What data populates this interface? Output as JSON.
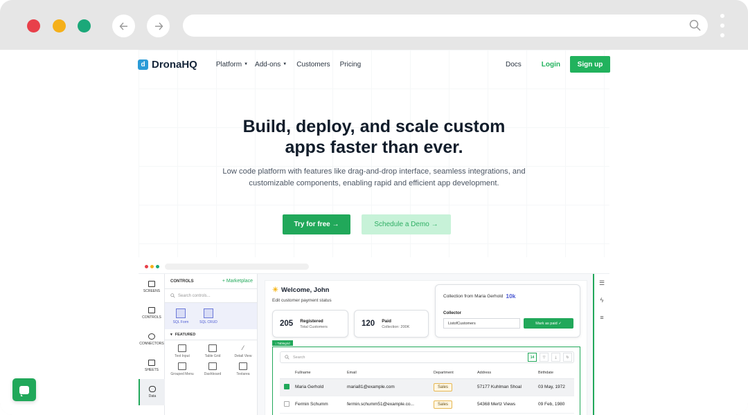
{
  "browser": {
    "traffic_lights": [
      "#e8404a",
      "#f5b01a",
      "#1ba879"
    ],
    "back_icon": "arrow-left-icon",
    "forward_icon": "arrow-right-icon",
    "url": "",
    "search_icon": "search-icon",
    "menu_icon": "kebab-menu-icon"
  },
  "header": {
    "logo_text": "DronaHQ",
    "nav": [
      {
        "label": "Platform",
        "dropdown": true
      },
      {
        "label": "Add-ons",
        "dropdown": true
      },
      {
        "label": "Customers",
        "dropdown": false
      },
      {
        "label": "Pricing",
        "dropdown": false
      }
    ],
    "docs": "Docs",
    "login": "Login",
    "signup": "Sign up"
  },
  "hero": {
    "title_line1": "Build, deploy, and scale custom",
    "title_line2": "apps faster than ever.",
    "subtitle": "Low code platform with features like drag-and-drop interface, seamless integrations, and customizable components, enabling rapid and efficient app development.",
    "cta_primary": "Try for free →",
    "cta_secondary": "Schedule a Demo →"
  },
  "app_preview": {
    "left_nav": [
      {
        "label": "SCREENS",
        "icon": "screens-icon"
      },
      {
        "label": "CONTROLS",
        "icon": "controls-icon"
      },
      {
        "label": "CONNECTORS",
        "icon": "connectors-icon"
      },
      {
        "label": "SHEETS",
        "icon": "sheets-icon"
      },
      {
        "label": "Data",
        "icon": "database-icon"
      }
    ],
    "controls": {
      "heading": "CONTROLS",
      "marketplace": "+ Marketplace",
      "search_placeholder": "Search controls...",
      "sql": [
        "SQL Form",
        "SQL CRUD"
      ],
      "featured": "FEATURED",
      "components": [
        "Text Input",
        "Table Grid",
        "Detail View",
        "Grouped Menu",
        "Dashboard",
        "Textarea"
      ]
    },
    "welcome": "Welcome, John",
    "welcome_sub": "Edit customer payment status",
    "stats": [
      {
        "value": "205",
        "label": "Registered",
        "sub": "Total Customers"
      },
      {
        "value": "120",
        "label": "Paid",
        "sub": "Collection: 200K"
      }
    ],
    "collection": {
      "title": "Collection from Maria Gerhold",
      "amount": "10k",
      "collector_label": "Collector",
      "input_value": "ListofCustomers",
      "button": "Mark as paid ✓"
    },
    "tablegrid": {
      "tag": "↕ Tablegrid",
      "search_placeholder": "Search",
      "badge": "14",
      "columns": [
        "Fullname",
        "Email",
        "Department",
        "Address",
        "Birthdate"
      ],
      "rows": [
        {
          "name": "Maria Gerhold",
          "email": "maria81@example.com",
          "dept": "Sales",
          "address": "57177 Kuhlman Shoal",
          "birthdate": "03 May, 1972",
          "checked": true
        },
        {
          "name": "Fermin Schumm",
          "email": "fermin.schumm51@example.co...",
          "dept": "Sales",
          "address": "54368 Mertz Views",
          "birthdate": "09 Feb, 1980",
          "checked": false
        }
      ]
    }
  }
}
